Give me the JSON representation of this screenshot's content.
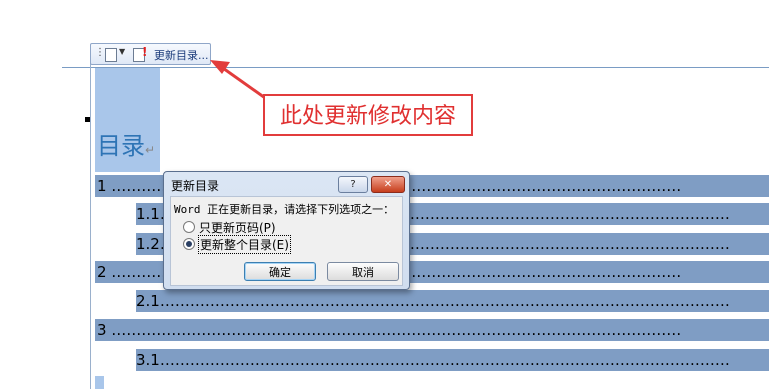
{
  "toolbar": {
    "update_label": "更新目录..."
  },
  "annotation": {
    "text": "此处更新修改内容",
    "color": "#e03030"
  },
  "document": {
    "toc_title": "目录",
    "mark": "↵",
    "rows": [
      "1 ……………………………………………………………………………………………………",
      "1.1……………………………………………………………………………………………………",
      "1.2……………………………………………………………………………………………………",
      "2 ……………………………………………………………………………………………………",
      "2.1……………………………………………………………………………………………………",
      "3 ……………………………………………………………………………………………………",
      "3.1……………………………………………………………………………………………………"
    ]
  },
  "dialog": {
    "title": "更新目录",
    "help": "?",
    "close": "✕",
    "prompt": "Word 正在更新目录，请选择下列选项之一：",
    "option1": "只更新页码(P)",
    "option2": "更新整个目录(E)",
    "selected": 2,
    "ok": "确定",
    "cancel": "取消"
  },
  "colors": {
    "toc_highlight": "#7f9dc4",
    "selection": "#a9c6ea",
    "title_blue": "#2e74b5"
  }
}
